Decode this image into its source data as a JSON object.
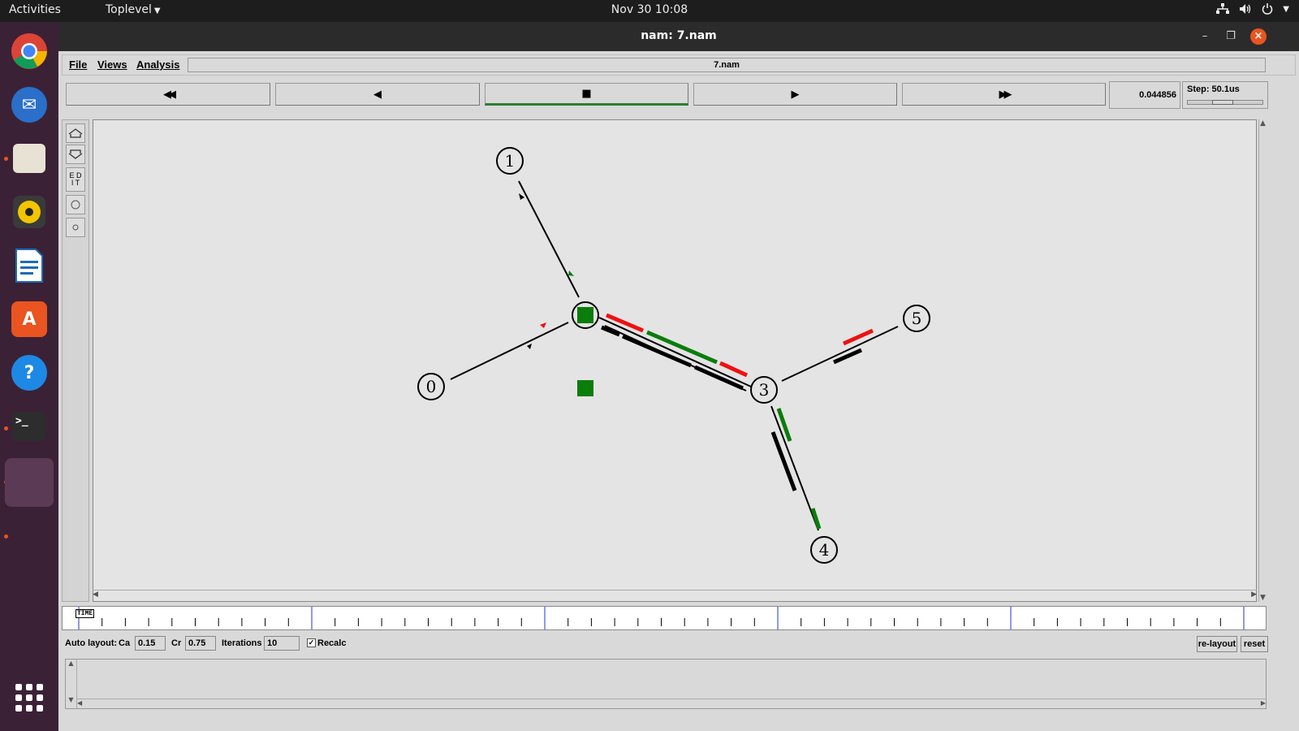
{
  "topbar": {
    "activities": "Activities",
    "app_menu": "Toplevel",
    "clock": "Nov 30  10:08"
  },
  "dock": {
    "items": [
      {
        "icon": "chrome-icon",
        "color": "#4285f4"
      },
      {
        "icon": "thunderbird-icon",
        "color": "#2a6fc9"
      },
      {
        "icon": "files-icon",
        "color": "#e8e2d4"
      },
      {
        "icon": "rhythmbox-icon",
        "color": "#f2c500"
      },
      {
        "icon": "libreoffice-writer-icon",
        "color": "#1e6bb8"
      },
      {
        "icon": "software-center-icon",
        "color": "#e95420"
      },
      {
        "icon": "help-icon",
        "color": "#1e88e5"
      },
      {
        "icon": "terminal-icon",
        "color": "#2d2d2d"
      }
    ]
  },
  "window": {
    "title": "nam: 7.nam"
  },
  "menubar": {
    "file": "File",
    "views": "Views",
    "analysis": "Analysis",
    "filename": "7.nam"
  },
  "controls": {
    "rewind": "◀◀",
    "back": "◀",
    "stop": "■",
    "play": "▶",
    "fast_forward": "▶▶",
    "time": "0.044856",
    "step": "Step: 50.1us"
  },
  "tools": {
    "edit": "E D\nI T"
  },
  "network": {
    "nodes": [
      "0",
      "1",
      "3",
      "4",
      "5"
    ],
    "colors": {
      "link": "#000000",
      "red_flow": "#ee1111",
      "green_flow": "#0a7d0a"
    }
  },
  "timeline": {
    "label": "TIME"
  },
  "autolayout": {
    "label": "Auto layout:",
    "ca_label": "Ca",
    "ca_value": "0.15",
    "cr_label": "Cr",
    "cr_value": "0.75",
    "iterations_label": "Iterations",
    "iterations_value": "10",
    "recalc_label": "Recalc",
    "relayout": "re-layout",
    "reset": "reset"
  }
}
